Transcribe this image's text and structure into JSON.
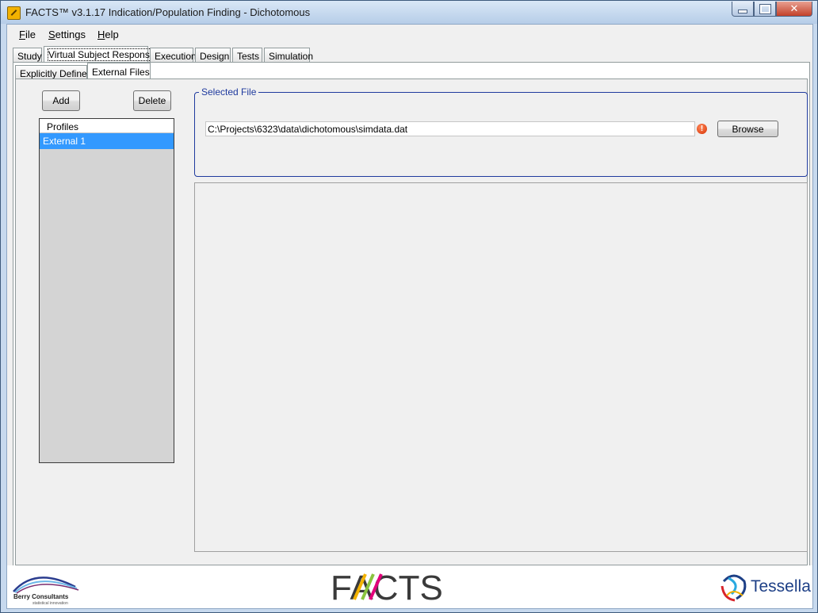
{
  "window": {
    "title": "FACTS™ v3.1.17 Indication/Population Finding - Dichotomous",
    "controls": {
      "close_glyph": "✕"
    }
  },
  "menu": [
    {
      "label": "File",
      "mnemonic": "F",
      "rest": "ile"
    },
    {
      "label": "Settings",
      "mnemonic": "S",
      "rest": "ettings"
    },
    {
      "label": "Help",
      "mnemonic": "H",
      "rest": "elp"
    }
  ],
  "main_tabs": [
    "Study",
    "Virtual Subject Response",
    "Execution",
    "Design",
    "Tests",
    "Simulation"
  ],
  "main_tab_selected": "Virtual Subject Response",
  "sub_tabs": [
    "Explicitly Defined",
    "External Files"
  ],
  "sub_tab_selected": "External Files",
  "profiles": {
    "add_label": "Add",
    "delete_label": "Delete",
    "header": "Profiles",
    "items": [
      "External 1"
    ],
    "selected": "External 1"
  },
  "selected_file": {
    "group_label": "Selected File",
    "path": "C:\\Projects\\6323\\data\\dichotomous\\simdata.dat",
    "error_glyph": "!",
    "browse_label": "Browse"
  },
  "footer": {
    "left_logo_text": "Berry Consultants",
    "left_logo_tagline": "statistical innovation",
    "center_logo_text": "FACTS",
    "right_logo_text": "Tessella"
  },
  "colors": {
    "selection": "#3399ff",
    "group_border": "#1f3a9e",
    "close_button": "#c3412a",
    "tessella_blue": "#1d3f86"
  },
  "icons": [
    "app-icon",
    "minimize-icon",
    "maximize-icon",
    "close-icon",
    "error-icon"
  ]
}
